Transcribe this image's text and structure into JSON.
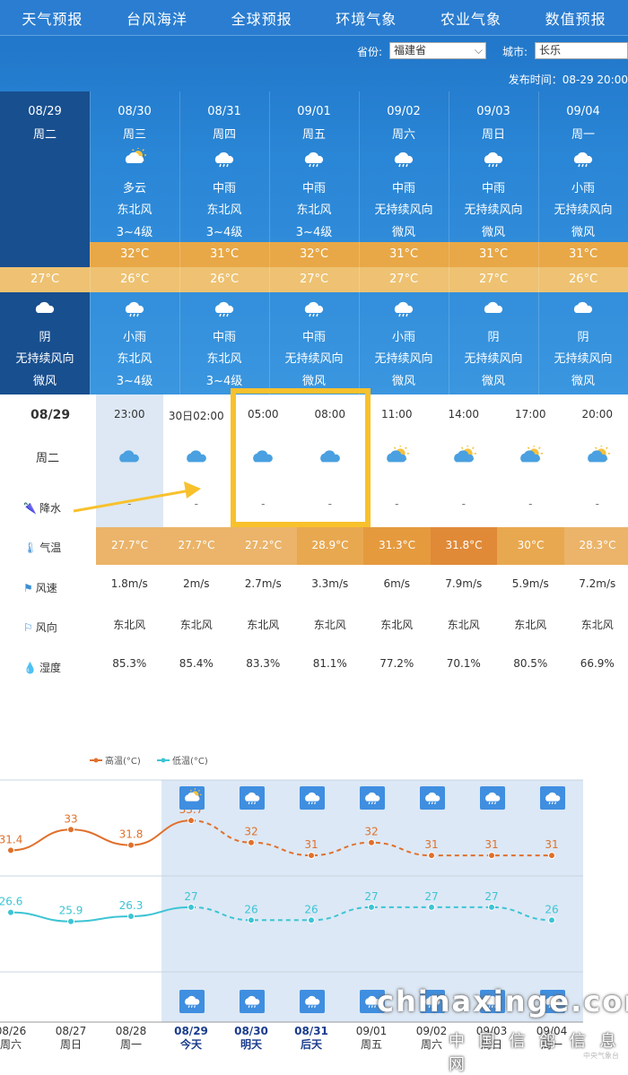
{
  "nav": [
    "天气预报",
    "台风海洋",
    "全球预报",
    "环境气象",
    "农业气象",
    "数值预报"
  ],
  "filters": {
    "province_label": "省份:",
    "province": "福建省",
    "city_label": "城市:",
    "city": "长乐",
    "published": "发布时间：08-29 20:00"
  },
  "days": [
    {
      "date": "08/29",
      "week": "周二",
      "day": null,
      "night": {
        "icon": "cloud-icon",
        "weather": "阴",
        "wind_dir": "无持续风向",
        "wind_scale": "微风"
      },
      "low": "27°C"
    },
    {
      "date": "08/30",
      "week": "周三",
      "day": {
        "icon": "partly-cloudy-icon",
        "weather": "多云",
        "wind_dir": "东北风",
        "wind_scale": "3~4级"
      },
      "high": "32°C",
      "low": "26°C",
      "night": {
        "icon": "rain-icon",
        "weather": "小雨",
        "wind_dir": "东北风",
        "wind_scale": "3~4级"
      }
    },
    {
      "date": "08/31",
      "week": "周四",
      "day": {
        "icon": "rain-icon",
        "weather": "中雨",
        "wind_dir": "东北风",
        "wind_scale": "3~4级"
      },
      "high": "31°C",
      "low": "26°C",
      "night": {
        "icon": "rain-icon",
        "weather": "中雨",
        "wind_dir": "东北风",
        "wind_scale": "3~4级"
      }
    },
    {
      "date": "09/01",
      "week": "周五",
      "day": {
        "icon": "rain-icon",
        "weather": "中雨",
        "wind_dir": "东北风",
        "wind_scale": "3~4级"
      },
      "high": "32°C",
      "low": "27°C",
      "night": {
        "icon": "rain-icon",
        "weather": "中雨",
        "wind_dir": "无持续风向",
        "wind_scale": "微风"
      }
    },
    {
      "date": "09/02",
      "week": "周六",
      "day": {
        "icon": "rain-icon",
        "weather": "中雨",
        "wind_dir": "无持续风向",
        "wind_scale": "微风"
      },
      "high": "31°C",
      "low": "27°C",
      "night": {
        "icon": "rain-icon",
        "weather": "小雨",
        "wind_dir": "无持续风向",
        "wind_scale": "微风"
      }
    },
    {
      "date": "09/03",
      "week": "周日",
      "day": {
        "icon": "rain-icon",
        "weather": "中雨",
        "wind_dir": "无持续风向",
        "wind_scale": "微风"
      },
      "high": "31°C",
      "low": "27°C",
      "night": {
        "icon": "cloud-icon",
        "weather": "阴",
        "wind_dir": "无持续风向",
        "wind_scale": "微风"
      }
    },
    {
      "date": "09/04",
      "week": "周一",
      "day": {
        "icon": "rain-icon",
        "weather": "小雨",
        "wind_dir": "无持续风向",
        "wind_scale": "微风"
      },
      "high": "31°C",
      "low": "26°C",
      "night": {
        "icon": "cloud-icon",
        "weather": "阴",
        "wind_dir": "无持续风向",
        "wind_scale": "微风"
      }
    }
  ],
  "hourly": {
    "date": "08/29",
    "week": "周二",
    "labels": {
      "precip": "降水",
      "temp": "气温",
      "wind_speed": "风速",
      "wind_dir": "风向",
      "humidity": "湿度"
    },
    "times": [
      "23:00",
      "30日02:00",
      "05:00",
      "08:00",
      "11:00",
      "14:00",
      "17:00",
      "20:00"
    ],
    "icons": [
      "cloud-icon",
      "cloud-icon",
      "cloud-icon",
      "cloud-icon",
      "partly-cloudy-icon",
      "partly-cloudy-icon",
      "partly-cloudy-icon",
      "partly-cloudy-icon"
    ],
    "precip": [
      "-",
      "-",
      "-",
      "-",
      "-",
      "-",
      "-",
      "-"
    ],
    "temps": [
      "27.7°C",
      "27.7°C",
      "27.2°C",
      "28.9°C",
      "31.3°C",
      "31.8°C",
      "30°C",
      "28.3°C"
    ],
    "temp_colors": [
      "#ebb46a",
      "#ebb46a",
      "#ebb46a",
      "#e8a850",
      "#e59a3e",
      "#e08a38",
      "#e8a850",
      "#ebb46a"
    ],
    "wind_speed": [
      "1.8m/s",
      "2m/s",
      "2.7m/s",
      "3.3m/s",
      "6m/s",
      "7.9m/s",
      "5.9m/s",
      "7.2m/s"
    ],
    "wind_dir": [
      "东北风",
      "东北风",
      "东北风",
      "东北风",
      "东北风",
      "东北风",
      "东北风",
      "东北风"
    ],
    "humidity": [
      "85.3%",
      "85.4%",
      "83.3%",
      "81.1%",
      "77.2%",
      "70.1%",
      "80.5%",
      "66.9%"
    ]
  },
  "chart_data": {
    "type": "line",
    "categories": [
      "08/26",
      "08/27",
      "08/28",
      "08/29",
      "08/30",
      "08/31",
      "09/01",
      "09/02",
      "09/03",
      "09/04"
    ],
    "sublabels": [
      "周六",
      "周日",
      "周一",
      "今天",
      "明天",
      "后天",
      "周五",
      "周六",
      "周日",
      "周一"
    ],
    "series": [
      {
        "name": "高温(°C)",
        "color": "#e0702c",
        "values": [
          31.4,
          33,
          31.8,
          33.7,
          32,
          31,
          32,
          31,
          31,
          31
        ],
        "labels": [
          "31.4",
          "33",
          "31.8",
          "33.7",
          "32",
          "31",
          "32",
          "31",
          "31",
          "31"
        ]
      },
      {
        "name": "低温(°C)",
        "color": "#3cc4d4",
        "values": [
          26.6,
          25.9,
          26.3,
          27,
          26,
          26,
          27,
          27,
          27,
          26
        ],
        "labels": [
          "26.6",
          "25.9",
          "26.3",
          "27",
          "26",
          "26",
          "27",
          "27",
          "27",
          "26"
        ]
      }
    ],
    "forecast_start_index": 3,
    "top_icons": [
      "partly-cloudy-icon",
      "rain-icon",
      "rain-icon",
      "rain-icon",
      "rain-icon",
      "rain-icon",
      "rain-icon"
    ],
    "bottom_icons": [
      "rain-icon",
      "rain-icon",
      "rain-icon",
      "rain-icon",
      "rain-icon",
      "rain-icon",
      "rain-icon"
    ]
  },
  "watermark": {
    "text": "chinaxinge.com",
    "cn": "中 国 信 鸽 信 息 网",
    "source": "中央气象台"
  }
}
